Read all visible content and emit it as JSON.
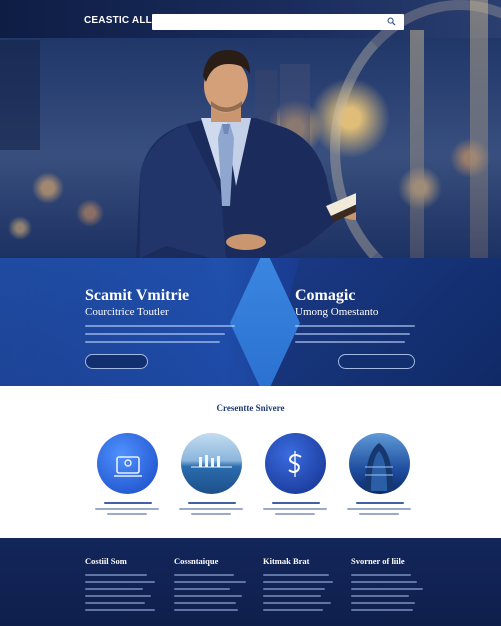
{
  "header": {
    "logo": "CEASTIC ALL",
    "nav_items": [
      "",
      "",
      ""
    ]
  },
  "panels": [
    {
      "title": "Scamit Vmitrie",
      "subtitle": "Courcitrice Toutler",
      "button_label": ""
    },
    {
      "title": "Comagic",
      "subtitle": "Umong Omestanto",
      "button_label": ""
    }
  ],
  "services": {
    "title": "Cresentte Snivere",
    "subtitle": "",
    "items": [
      {
        "icon": "person-screen-icon"
      },
      {
        "icon": "sea-horizon-icon"
      },
      {
        "icon": "dollar-icon"
      },
      {
        "icon": "building-icon"
      }
    ]
  },
  "footer": {
    "columns": [
      {
        "title": "Costiil Som"
      },
      {
        "title": "Cossntaique"
      },
      {
        "title": "Kitmak Brat"
      },
      {
        "title": "Svorner of liile"
      }
    ]
  },
  "colors": {
    "brand_dark": "#13265a",
    "brand_blue": "#1f4ca8",
    "accent_blue": "#3b88e0",
    "text_blue": "#1f3a78"
  }
}
